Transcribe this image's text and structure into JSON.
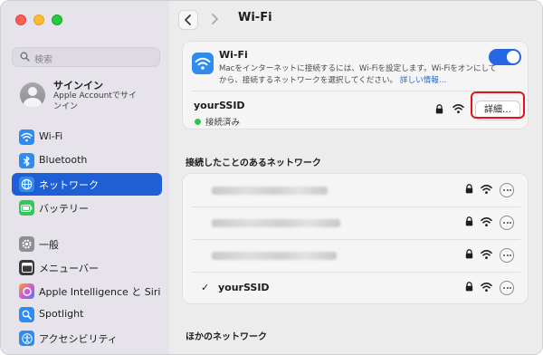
{
  "sidebar": {
    "search_placeholder": "検索",
    "account": {
      "title": "サインイン",
      "subtitle": "Apple Accountでサインイン"
    },
    "items": [
      {
        "label": "Wi-Fi",
        "icon": "wifi-icon",
        "color": "#2e8bf0",
        "selected": false
      },
      {
        "label": "Bluetooth",
        "icon": "bluetooth-icon",
        "color": "#2e8bf0",
        "selected": false
      },
      {
        "label": "ネットワーク",
        "icon": "globe-icon",
        "color": "#2e8bf0",
        "selected": true
      },
      {
        "label": "バッテリー",
        "icon": "battery-icon",
        "color": "#34c759",
        "selected": false
      },
      {
        "label": "一般",
        "icon": "gear-icon",
        "color": "#8e8e93",
        "selected": false
      },
      {
        "label": "メニューバー",
        "icon": "menubar-icon",
        "color": "#3a3a3c",
        "selected": false
      },
      {
        "label": "Apple Intelligence と Siri",
        "icon": "siri-icon",
        "color": "#d45bd0",
        "selected": false
      },
      {
        "label": "Spotlight",
        "icon": "spotlight-icon",
        "color": "#2e8bf0",
        "selected": false
      },
      {
        "label": "アクセシビリティ",
        "icon": "accessibility-icon",
        "color": "#2e8bf0",
        "selected": false
      }
    ]
  },
  "header": {
    "title": "Wi-Fi"
  },
  "wifi": {
    "title": "Wi-Fi",
    "description": "Macをインターネットに接続するには、Wi-Fiを設定します。Wi-Fiをオンにしてから、接続するネットワークを選択してください。",
    "link": "詳しい情報…",
    "enabled": true
  },
  "current": {
    "ssid": "yourSSID",
    "status": "接続済み",
    "detail_button": "詳細…"
  },
  "known": {
    "title": "接続したことのあるネットワーク",
    "networks": [
      {
        "name": "",
        "blurred": true,
        "checked": false
      },
      {
        "name": "",
        "blurred": true,
        "checked": false
      },
      {
        "name": "",
        "blurred": true,
        "checked": false
      },
      {
        "name": "yourSSID",
        "blurred": false,
        "checked": true
      }
    ]
  },
  "other": {
    "title": "ほかのネットワーク"
  },
  "colors": {
    "accent": "#1f5fd6",
    "highlight": "#e0141e",
    "connected": "#31c24d"
  }
}
